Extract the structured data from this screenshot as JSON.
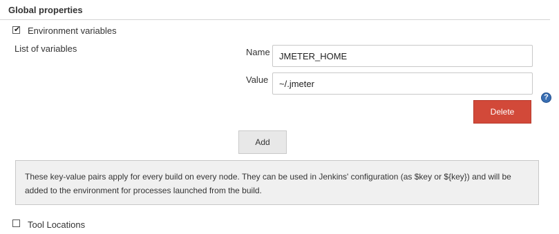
{
  "section": {
    "title": "Global properties"
  },
  "env_vars": {
    "checkbox_label": "Environment variables",
    "checked": true,
    "list_label": "List of variables",
    "name_label": "Name",
    "name_value": "JMETER_HOME",
    "value_label": "Value",
    "value_value": "~/.jmeter",
    "delete_label": "Delete",
    "add_label": "Add",
    "help_icon_glyph": "?",
    "help_text": "These key-value pairs apply for every build on every node. They can be used in Jenkins' configuration (as $key or ${key}) and will be added to the environment for processes launched from the build."
  },
  "tool_locations": {
    "checkbox_label": "Tool Locations",
    "checked": false
  },
  "colors": {
    "delete_button": "#d24939",
    "add_button": "#e8e8e8",
    "help_icon": "#3a6fb3",
    "help_box_bg": "#f0f0f0"
  }
}
